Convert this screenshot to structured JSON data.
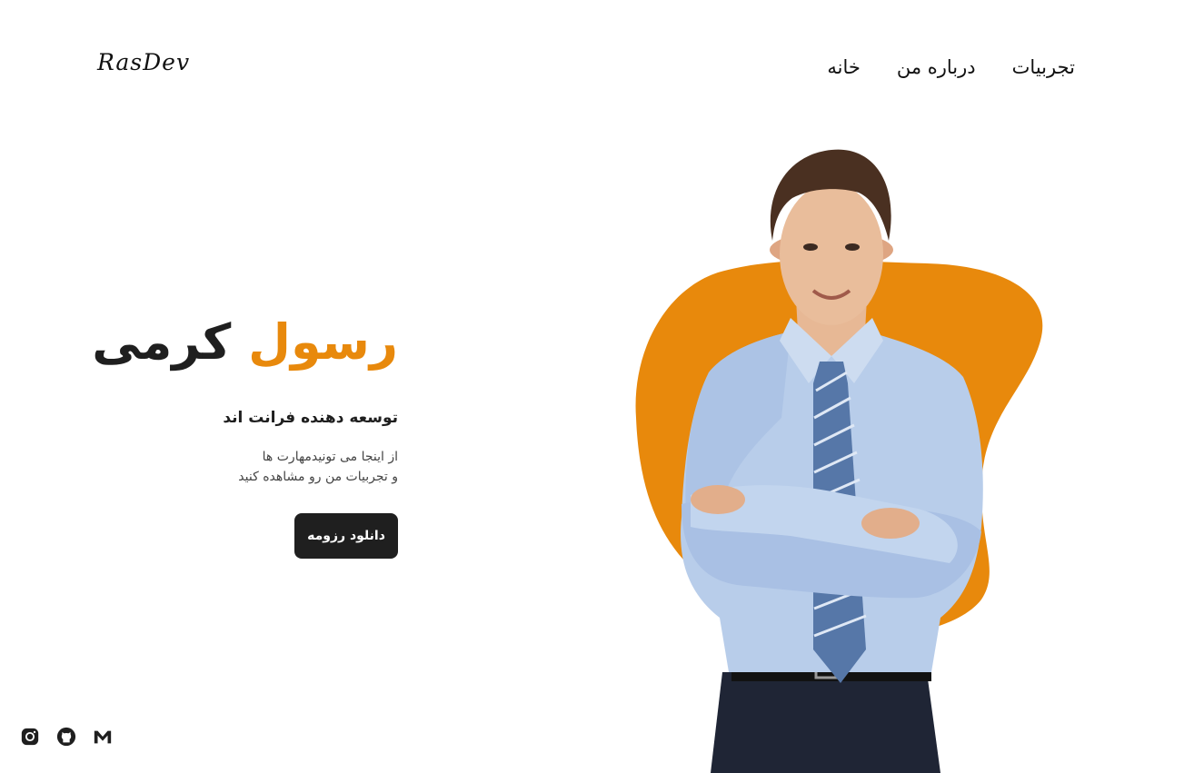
{
  "brand": {
    "logo": "RasDev"
  },
  "nav": {
    "items": [
      "تجربیات",
      "درباره من",
      "خانه"
    ]
  },
  "hero": {
    "name_first": "رسول",
    "name_last": "کرمی",
    "subtitle": "توسعه دهنده فرانت اند",
    "description_line1": "از اینجا می تونیدمهارت ها",
    "description_line2": "و تجربیات من رو مشاهده کنید",
    "cta_label": "دانلود رزومه"
  },
  "socials": [
    "instagram-icon",
    "github-icon",
    "gmail-icon"
  ],
  "colors": {
    "accent": "#e8890c",
    "dark": "#1f1f1f",
    "shirt": "#b8cdea",
    "tie": "#5677a8"
  }
}
